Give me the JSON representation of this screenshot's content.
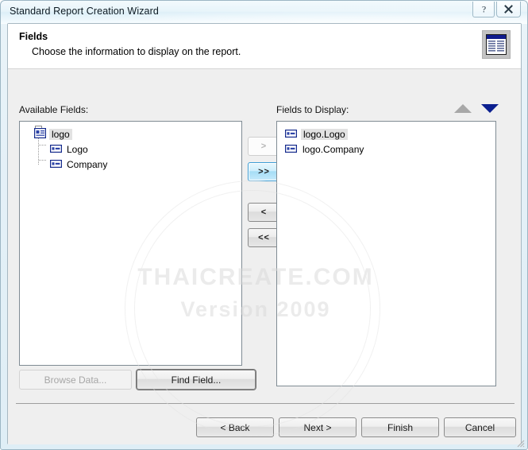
{
  "window": {
    "title": "Standard Report Creation Wizard",
    "help_icon": "help-question-icon",
    "close_icon": "close-x-icon"
  },
  "header": {
    "title": "Fields",
    "subtitle": "Choose the information to display on the report.",
    "icon": "report-grid-icon"
  },
  "available_fields": {
    "label": "Available Fields:",
    "tree": {
      "root": {
        "label": "logo",
        "icon": "table-icon",
        "expanded": true,
        "selected": true
      },
      "children": [
        {
          "label": "Logo",
          "icon": "field-icon"
        },
        {
          "label": "Company",
          "icon": "field-icon"
        }
      ]
    }
  },
  "transfer_buttons": [
    {
      "label": ">",
      "name": "add-field-button",
      "state": "disabled"
    },
    {
      "label": ">>",
      "name": "add-all-fields-button",
      "state": "hover"
    },
    {
      "label": "<",
      "name": "remove-field-button",
      "state": "normal"
    },
    {
      "label": "<<",
      "name": "remove-all-fields-button",
      "state": "normal"
    }
  ],
  "fields_to_display": {
    "label": "Fields to Display:",
    "sort_up_icon": "move-up-arrow-icon",
    "sort_down_icon": "move-down-arrow-icon",
    "items": [
      {
        "label": "logo.Logo",
        "icon": "field-icon",
        "selected": true
      },
      {
        "label": "logo.Company",
        "icon": "field-icon",
        "selected": false
      }
    ]
  },
  "side_buttons": {
    "browse_data": "Browse Data...",
    "find_field": "Find Field..."
  },
  "footer_buttons": {
    "back": "< Back",
    "next": "Next >",
    "finish": "Finish",
    "cancel": "Cancel"
  },
  "watermark": {
    "main": "THAICREATE.COM",
    "sub": "Version 2009"
  },
  "colors": {
    "accent_blue": "#3c9ed6",
    "arrow_navy": "#0b1f8f",
    "window_border": "#9cb6c4",
    "dialog_bg": "#efefef"
  }
}
